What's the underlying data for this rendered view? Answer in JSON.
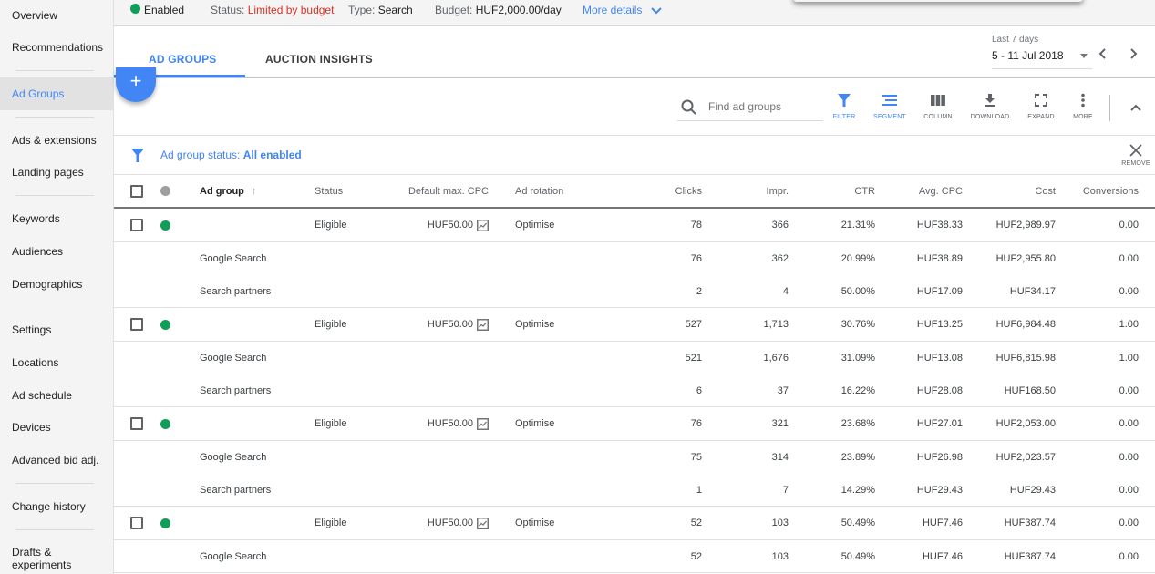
{
  "sidebar": {
    "items": [
      {
        "label": "Overview"
      },
      {
        "label": "Recommendations"
      },
      {
        "label": "Ad Groups",
        "active": true
      },
      {
        "label": "Ads & extensions"
      },
      {
        "label": "Landing pages"
      },
      {
        "label": "Keywords"
      },
      {
        "label": "Audiences"
      },
      {
        "label": "Demographics"
      },
      {
        "label": "Settings"
      },
      {
        "label": "Locations"
      },
      {
        "label": "Ad schedule"
      },
      {
        "label": "Devices"
      },
      {
        "label": "Advanced bid adj."
      },
      {
        "label": "Change history"
      },
      {
        "label": "Drafts &"
      },
      {
        "label": "experiments"
      }
    ]
  },
  "summary": {
    "enabled": "Enabled",
    "status_label": "Status:",
    "status_value": "Limited by budget",
    "type_label": "Type:",
    "type_value": "Search",
    "budget_label": "Budget:",
    "budget_value": "HUF2,000.00/day",
    "more_details": "More details",
    "status_color": "#0f9d58"
  },
  "tabs": [
    {
      "label": "AD GROUPS",
      "active": true
    },
    {
      "label": "AUCTION INSIGHTS"
    }
  ],
  "date_range": {
    "label": "Last 7 days",
    "value": "5 - 11 Jul 2018"
  },
  "toolbar": {
    "search_placeholder": "Find ad groups",
    "filter": "FILTER",
    "segment": "SEGMENT",
    "column": "COLUMN",
    "download": "DOWNLOAD",
    "expand": "EXPAND",
    "more": "MORE",
    "add": "+"
  },
  "filter": {
    "label": "Ad group status:",
    "value": "All enabled",
    "remove": "REMOVE"
  },
  "table": {
    "headers": {
      "ad_group": "Ad group",
      "status": "Status",
      "cpc": "Default max. CPC",
      "rotation": "Ad rotation",
      "clicks": "Clicks",
      "impr": "Impr.",
      "ctr": "CTR",
      "avg_cpc": "Avg. CPC",
      "cost": "Cost",
      "conversions": "Conversions"
    },
    "groups": [
      {
        "status": "Eligible",
        "cpc": "HUF50.00",
        "rotation": "Optimise",
        "clicks": "78",
        "impr": "366",
        "ctr": "21.31%",
        "avg_cpc": "HUF38.33",
        "cost": "HUF2,989.97",
        "conversions": "0.00",
        "segments": [
          {
            "name": "Google Search",
            "clicks": "76",
            "impr": "362",
            "ctr": "20.99%",
            "avg_cpc": "HUF38.89",
            "cost": "HUF2,955.80",
            "conversions": "0.00"
          },
          {
            "name": "Search partners",
            "clicks": "2",
            "impr": "4",
            "ctr": "50.00%",
            "avg_cpc": "HUF17.09",
            "cost": "HUF34.17",
            "conversions": "0.00"
          }
        ]
      },
      {
        "status": "Eligible",
        "cpc": "HUF50.00",
        "rotation": "Optimise",
        "clicks": "527",
        "impr": "1,713",
        "ctr": "30.76%",
        "avg_cpc": "HUF13.25",
        "cost": "HUF6,984.48",
        "conversions": "1.00",
        "segments": [
          {
            "name": "Google Search",
            "clicks": "521",
            "impr": "1,676",
            "ctr": "31.09%",
            "avg_cpc": "HUF13.08",
            "cost": "HUF6,815.98",
            "conversions": "1.00"
          },
          {
            "name": "Search partners",
            "clicks": "6",
            "impr": "37",
            "ctr": "16.22%",
            "avg_cpc": "HUF28.08",
            "cost": "HUF168.50",
            "conversions": "0.00"
          }
        ]
      },
      {
        "status": "Eligible",
        "cpc": "HUF50.00",
        "rotation": "Optimise",
        "clicks": "76",
        "impr": "321",
        "ctr": "23.68%",
        "avg_cpc": "HUF27.01",
        "cost": "HUF2,053.00",
        "conversions": "0.00",
        "segments": [
          {
            "name": "Google Search",
            "clicks": "75",
            "impr": "314",
            "ctr": "23.89%",
            "avg_cpc": "HUF26.98",
            "cost": "HUF2,023.57",
            "conversions": "0.00"
          },
          {
            "name": "Search partners",
            "clicks": "1",
            "impr": "7",
            "ctr": "14.29%",
            "avg_cpc": "HUF29.43",
            "cost": "HUF29.43",
            "conversions": "0.00"
          }
        ]
      },
      {
        "status": "Eligible",
        "cpc": "HUF50.00",
        "rotation": "Optimise",
        "clicks": "52",
        "impr": "103",
        "ctr": "50.49%",
        "avg_cpc": "HUF7.46",
        "cost": "HUF387.74",
        "conversions": "0.00",
        "segments": [
          {
            "name": "Google Search",
            "clicks": "52",
            "impr": "103",
            "ctr": "50.49%",
            "avg_cpc": "HUF7.46",
            "cost": "HUF387.74",
            "conversions": "0.00"
          }
        ]
      }
    ]
  },
  "colors": {
    "accent": "#4285f4",
    "enabled": "#0f9d58",
    "warning": "#d93025"
  }
}
